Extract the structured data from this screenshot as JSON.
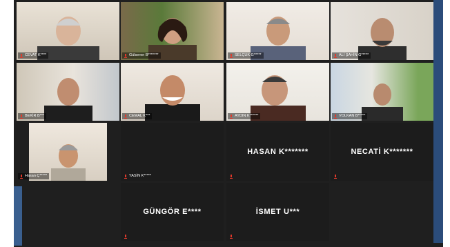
{
  "meeting": {
    "participants": [
      {
        "id": "p1",
        "label": "CEVAT K****",
        "center_name": "",
        "video": true
      },
      {
        "id": "p2",
        "label": "Gülseren B*******",
        "center_name": "",
        "video": true
      },
      {
        "id": "p3",
        "label": "SELÇUK G*****",
        "center_name": "",
        "video": true
      },
      {
        "id": "p4",
        "label": "ALİ ŞAHİN G*****",
        "center_name": "",
        "video": true
      },
      {
        "id": "p5",
        "label": "BEKİR B***",
        "center_name": "",
        "video": true
      },
      {
        "id": "p6",
        "label": "CEMAL K***",
        "center_name": "",
        "video": true
      },
      {
        "id": "p7",
        "label": "AYDIN K******",
        "center_name": "",
        "video": true
      },
      {
        "id": "p8",
        "label": "VOLKAN B*****",
        "center_name": "",
        "video": true
      },
      {
        "id": "p9",
        "label": "Hasan Ç*****",
        "center_name": "",
        "video": true
      },
      {
        "id": "p10",
        "label": "YASİN K*****",
        "center_name": "",
        "video": false
      },
      {
        "id": "p11",
        "label": "",
        "center_name": "HASAN K*******",
        "video": false
      },
      {
        "id": "p12",
        "label": "",
        "center_name": "NECATİ K*******",
        "video": false
      },
      {
        "id": "p13",
        "label": "",
        "center_name": "GÜNGÖR E****",
        "video": false
      },
      {
        "id": "p14",
        "label": "",
        "center_name": "İSMET U***",
        "video": false
      }
    ]
  },
  "colors": {
    "muted_mic": "#e0392b",
    "active_speaker_border": "#b7d15a"
  },
  "icons": {
    "muted": "muted-mic-icon"
  }
}
